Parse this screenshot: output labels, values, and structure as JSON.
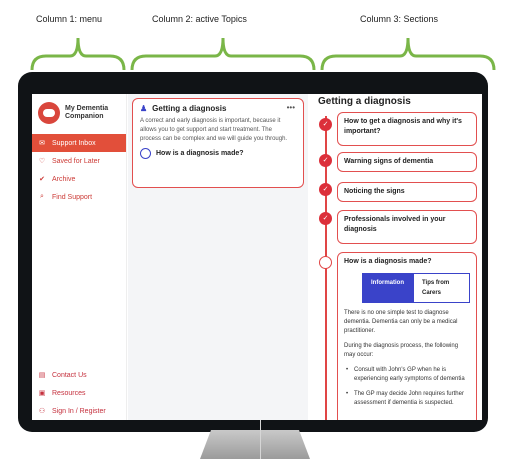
{
  "labels": {
    "col1": "Column 1: menu",
    "col2": "Column 2: active Topics",
    "col3": "Column 3: Sections"
  },
  "colors": {
    "accent": "#e24f3a",
    "border_red": "#e24f4f",
    "primary_blue": "#3a43c9"
  },
  "app": {
    "name": "My Dementia Companion"
  },
  "menu": {
    "top": [
      {
        "label": "Support Inbox",
        "icon": "inbox-icon",
        "active": true
      },
      {
        "label": "Saved for Later",
        "icon": "heart-icon",
        "active": false
      },
      {
        "label": "Archive",
        "icon": "check-circle-icon",
        "active": false
      },
      {
        "label": "Find Support",
        "icon": "search-icon",
        "active": false
      }
    ],
    "bottom": [
      {
        "label": "Contact Us",
        "icon": "chat-icon"
      },
      {
        "label": "Resources",
        "icon": "document-icon"
      },
      {
        "label": "Sign In / Register",
        "icon": "user-icon"
      }
    ]
  },
  "topic": {
    "title": "Getting a diagnosis",
    "more": "•••",
    "body": "A correct and early diagnosis is important, because it allows you to get support and start treatment. The process can be complex and we will guide you through.",
    "question": "How is a diagnosis made?"
  },
  "sections": {
    "title": "Getting a diagnosis",
    "items": [
      "How to get a diagnosis and why it's important?",
      "Warning signs of dementia",
      "Noticing the signs",
      "Professionals involved in your diagnosis",
      "How is a diagnosis made?"
    ],
    "tabs": {
      "active": "Information",
      "inactive": "Tips from Carers"
    },
    "content": [
      "There is no one simple test to diagnose dementia. Dementia can only be a medical practitioner.",
      "During the diagnosis process, the following may occur:"
    ],
    "bullets": [
      "Consult with John's GP when he is experiencing early symptoms of dementia",
      "The GP may decide John requires further assessment if dementia is suspected."
    ]
  }
}
